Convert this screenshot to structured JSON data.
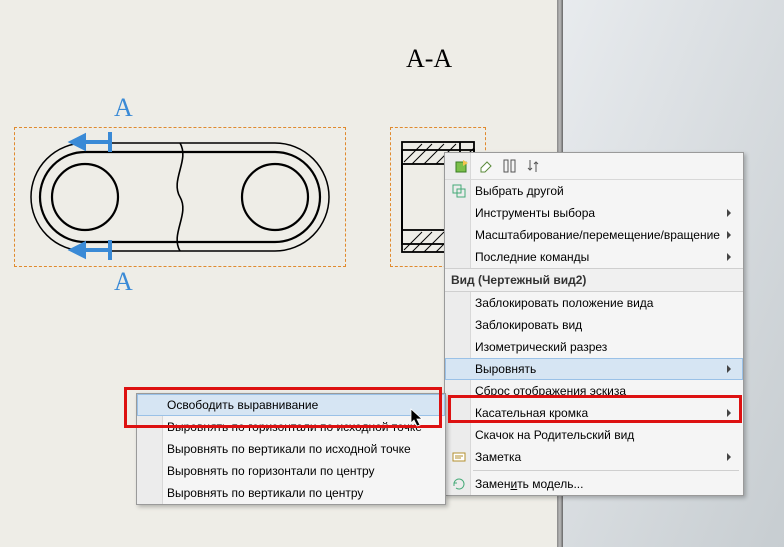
{
  "section_label": "A-A",
  "section_marks": {
    "top": "A",
    "bottom": "A"
  },
  "toolbar": {
    "icons": [
      "props-icon",
      "eraser-icon",
      "columns-icon",
      "sort-icon"
    ]
  },
  "menu": {
    "select_other": "Выбрать другой",
    "selection_tools": "Инструменты выбора",
    "zoom_pan_rotate": "Масштабирование/перемещение/вращение",
    "recent": "Последние команды",
    "header": "Вид (Чертежный вид2)",
    "lock_position": "Заблокировать положение вида",
    "lock_view": "Заблокировать вид",
    "isometric_section": "Изометрический разрез",
    "align": "Выровнять",
    "reset_sketch": "Сброс отображения эскиза",
    "tangent_edge": "Касательная кромка",
    "jump_parent": "Скачок на Родительский вид",
    "note": "Заметка",
    "replace_model": "Заменить модель..."
  },
  "submenu": {
    "break": "Освободить выравнивание",
    "horiz_origin": "Выровнять по горизонтали по исходной точке",
    "vert_origin": "Выровнять по вертикали по исходной точке",
    "horiz_center": "Выровнять по горизонтали по центру",
    "vert_center": "Выровнять по вертикали по центру"
  }
}
